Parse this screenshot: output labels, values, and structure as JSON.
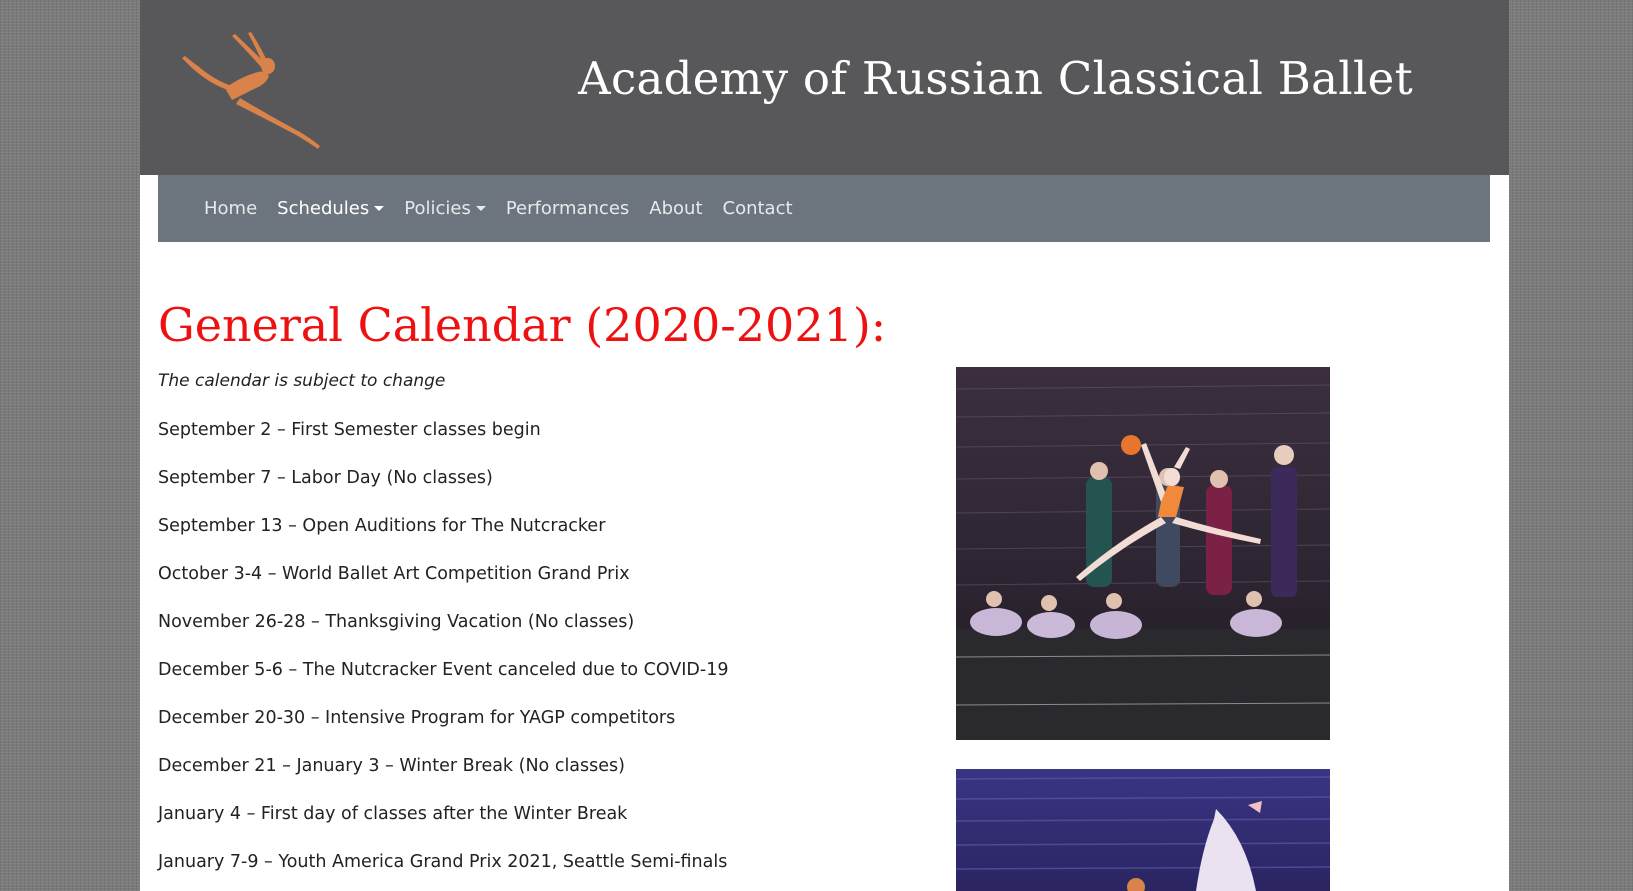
{
  "site": {
    "title": "Academy of Russian Classical Ballet",
    "logo_icon": "ballet-dancer-leap-icon"
  },
  "nav": {
    "items": [
      {
        "label": "Home",
        "dropdown": false,
        "active": false
      },
      {
        "label": "Schedules",
        "dropdown": true,
        "active": true
      },
      {
        "label": "Policies",
        "dropdown": true,
        "active": false
      },
      {
        "label": "Performances",
        "dropdown": false,
        "active": false
      },
      {
        "label": "About",
        "dropdown": false,
        "active": false
      },
      {
        "label": "Contact",
        "dropdown": false,
        "active": false
      }
    ]
  },
  "content": {
    "title": "General Calendar (2020-2021):",
    "subtitle": "The calendar is subject to change",
    "events": [
      "September 2 – First Semester classes begin",
      "September 7 – Labor Day (No classes)",
      "September 13 – Open Auditions for The Nutcracker",
      "October 3-4 – World Ballet Art Competition Grand Prix",
      "November 26-28 – Thanksgiving Vacation (No classes)",
      "December 5-6 – The Nutcracker Event canceled due to COVID-19",
      "December 20-30 – Intensive Program for YAGP competitors",
      "December 21 – January 3 – Winter Break (No classes)",
      "January 4 – First day of classes after the Winter Break",
      "January 7-9 – Youth America Grand Prix 2021, Seattle Semi-finals"
    ]
  },
  "colors": {
    "header_bg": "#58585a",
    "navbar_bg": "#6c757d",
    "title_red": "#ee1111",
    "logo_orange": "#d9824a"
  }
}
